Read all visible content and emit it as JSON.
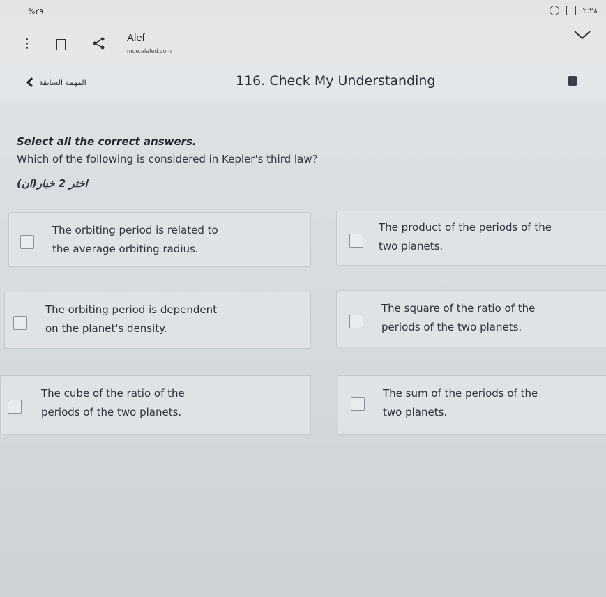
{
  "status_bar": {
    "left_text": "%٢٩",
    "right_text": "٢:٢٨"
  },
  "browser": {
    "site_title": "Alef",
    "site_url": "moe.alefed.com"
  },
  "header": {
    "back_label": "المهمة السابقة",
    "page_title": "116. Check My Understanding"
  },
  "question": {
    "instruction": "Select all the correct answers.",
    "text": "Which of the following is considered in Kepler's third law?",
    "hint_ar": "اختر 2 خيار(ان)"
  },
  "options": [
    {
      "text": "The orbiting period is related to\nthe average orbiting radius.",
      "checked": false
    },
    {
      "text": "The product of the periods of the\ntwo planets.",
      "checked": false
    },
    {
      "text": "The orbiting period is dependent\non the planet's density.",
      "checked": false
    },
    {
      "text": "The square of the ratio of the\nperiods of the two planets.",
      "checked": false
    },
    {
      "text": "The cube of the ratio of the\nperiods of the two planets.",
      "checked": false
    },
    {
      "text": "The sum of the periods of the\ntwo planets.",
      "checked": false
    }
  ],
  "icons": {
    "menu": "more-vert-icon",
    "bookmark": "bookmark-icon",
    "share": "share-icon",
    "expand": "chevron-down-icon",
    "back": "chevron-left-icon"
  }
}
